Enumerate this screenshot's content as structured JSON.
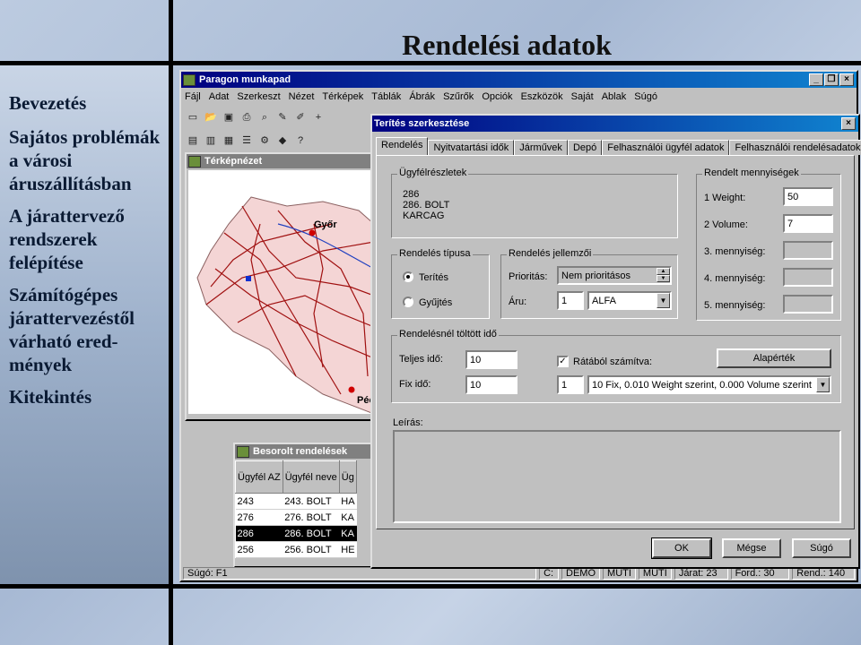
{
  "slide": {
    "title": "Rendelési adatok",
    "nav": [
      "Bevezetés",
      "Sajátos problémák a városi áruszállításban",
      "A járattervező rendszerek felépítése",
      "Számítógépes járattervezéstől várható ered-mények",
      "Kitekintés"
    ]
  },
  "app": {
    "title": "Paragon munkapad",
    "menu": [
      "Fájl",
      "Adat",
      "Szerkeszt",
      "Nézet",
      "Térképek",
      "Táblák",
      "Ábrák",
      "Szűrők",
      "Opciók",
      "Eszközök",
      "Saját",
      "Ablak",
      "Súgó"
    ],
    "status": [
      "Súgó: F1",
      "C:",
      "DEMO",
      "MUTI",
      "MUTI",
      "Járat:  23",
      "Ford.:  30",
      "Rend.: 140"
    ]
  },
  "map_window": {
    "title": "Térképnézet",
    "cities": [
      "Győr",
      "Péc"
    ]
  },
  "orders_window": {
    "title": "Besorolt rendelések",
    "columns": [
      "Ügyfél AZ",
      "Ügyfél neve",
      "Üg"
    ],
    "rows": [
      [
        "243",
        "243. BOLT",
        "HA"
      ],
      [
        "276",
        "276. BOLT",
        "KA"
      ],
      [
        "286",
        "286. BOLT",
        "KA"
      ],
      [
        "256",
        "256. BOLT",
        "HE"
      ]
    ],
    "selected_row": 2
  },
  "dialog": {
    "title": "Terítés szerkesztése",
    "tabs": [
      "Rendelés",
      "Nyitvatartási idők",
      "Járművek",
      "Depó",
      "Felhasználói ügyfél adatok",
      "Felhasználói rendelésadatok"
    ],
    "customer": {
      "label": "Ügyfélrészletek",
      "lines": [
        "286",
        "286. BOLT",
        "KARCAG"
      ]
    },
    "quantities": {
      "label": "Rendelt mennyiségek",
      "rows": [
        {
          "label": "1 Weight:",
          "value": "50"
        },
        {
          "label": "2 Volume:",
          "value": "7"
        },
        {
          "label": "3. mennyiség:",
          "value": ""
        },
        {
          "label": "4. mennyiség:",
          "value": ""
        },
        {
          "label": "5. mennyiség:",
          "value": ""
        }
      ]
    },
    "type": {
      "label": "Rendelés típusa",
      "options": [
        "Terítés",
        "Gyűjtés"
      ],
      "selected": "Terítés"
    },
    "traits": {
      "label": "Rendelés jellemzői",
      "priority_label": "Prioritás:",
      "priority_value": "Nem prioritásos",
      "goods_label": "Áru:",
      "goods_num": "1",
      "goods_value": "ALFA"
    },
    "time": {
      "label": "Rendelésnél töltött idő",
      "total_label": "Teljes idő:",
      "total_value": "10",
      "fix_label": "Fix idő:",
      "fix_value": "10",
      "rate_check_label": "Rátából számítva:",
      "rate_checked": true,
      "default_button": "Alapérték",
      "rate_num": "1",
      "rate_value": "10 Fix,   0.010 Weight szerint,   0.000 Volume szerint"
    },
    "description_label": "Leírás:",
    "buttons": [
      "OK",
      "Mégse",
      "Súgó"
    ]
  }
}
